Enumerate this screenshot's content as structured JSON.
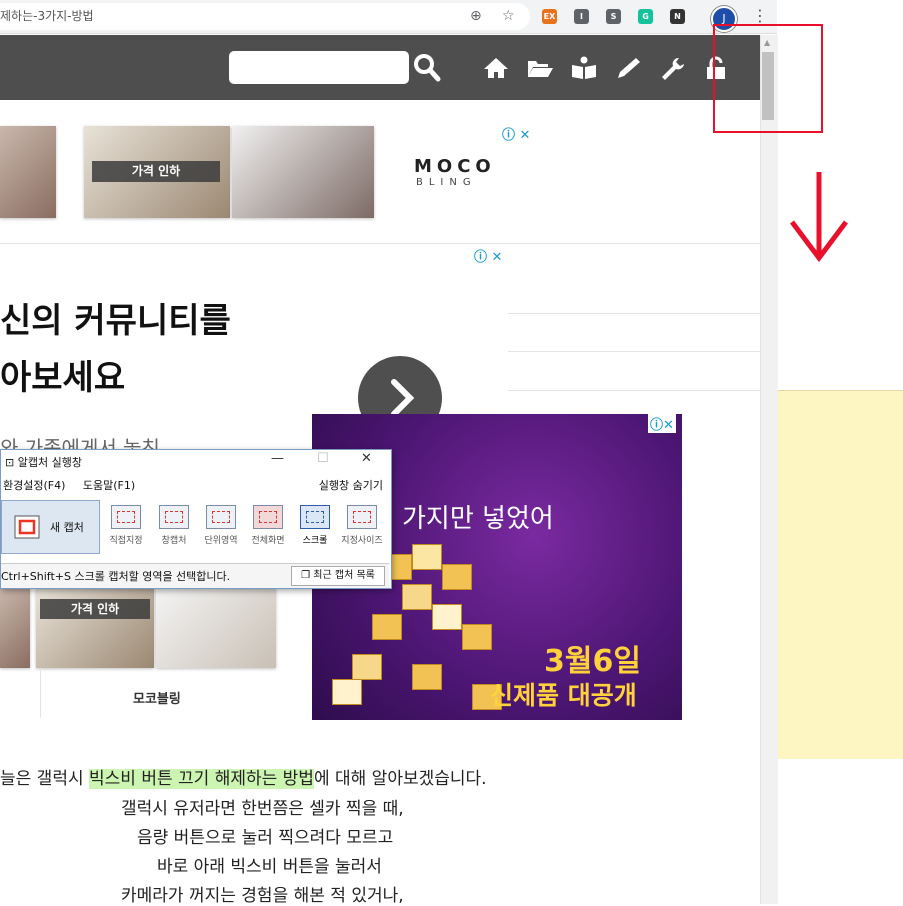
{
  "browser": {
    "url_text": "제하는-3가지-방법",
    "profile_initial": "J",
    "extensions": [
      {
        "name": "ex-extension-icon",
        "label": "EX",
        "color": "#e8711c"
      },
      {
        "name": "i-extension-icon",
        "label": "I",
        "color": "#5f6368"
      },
      {
        "name": "s-extension-icon",
        "label": "S",
        "color": "#5f6368"
      },
      {
        "name": "grammarly-extension-icon",
        "label": "G",
        "color": "#15c39a"
      },
      {
        "name": "notion-extension-icon",
        "label": "N",
        "color": "#333333"
      }
    ]
  },
  "ads": {
    "top_badge": "가격 인하",
    "brand_line1": "MOCO",
    "brand_line2": "BLING",
    "bottom_badge": "가격 인하",
    "bottom_brand": "모코블링"
  },
  "promo": {
    "headline_line1": "신의 커뮤니티를",
    "headline_line2": "아보세요",
    "subline": "와 가족에게서 놓친"
  },
  "purple_ad": {
    "text": "가지만 넣었어",
    "title": "3월6일",
    "subtitle": "신제품 대공개"
  },
  "capture_window": {
    "title": "알캡처 실행창",
    "menu_settings": "환경설정(F4)",
    "menu_help": "도움말(F1)",
    "menu_hide": "실행창 숨기기",
    "new_capture": "새 캡처",
    "tools": [
      "직접지정",
      "창캡처",
      "단위영역",
      "전체화면",
      "스크롤",
      "지정사이즈"
    ],
    "status": "Ctrl+Shift+S 스크롤 캡처할 영역을 선택합니다.",
    "recent_button": "최근 캡처 목록"
  },
  "article": {
    "line1_before": "늘은 갤럭시 ",
    "line1_highlight": "빅스비 버튼 끄기 해제하는 방법",
    "line1_after": "에 대해 알아보겠습니다.",
    "line2": "갤럭시 유저라면 한번쯤은 셀카 찍을 때,",
    "line3": "음량 버튼으로 눌러 찍으려다 모르고",
    "line4": "바로 아래 빅스비 버튼을 눌러서",
    "line5": "카메라가 꺼지는 경험을 해본 적 있거나,"
  },
  "colors": {
    "header_bg": "#4e4e4e",
    "annotation_red": "#e8102b",
    "highlight": "#cdf5b2",
    "sticky_note": "#fdf5c2"
  }
}
